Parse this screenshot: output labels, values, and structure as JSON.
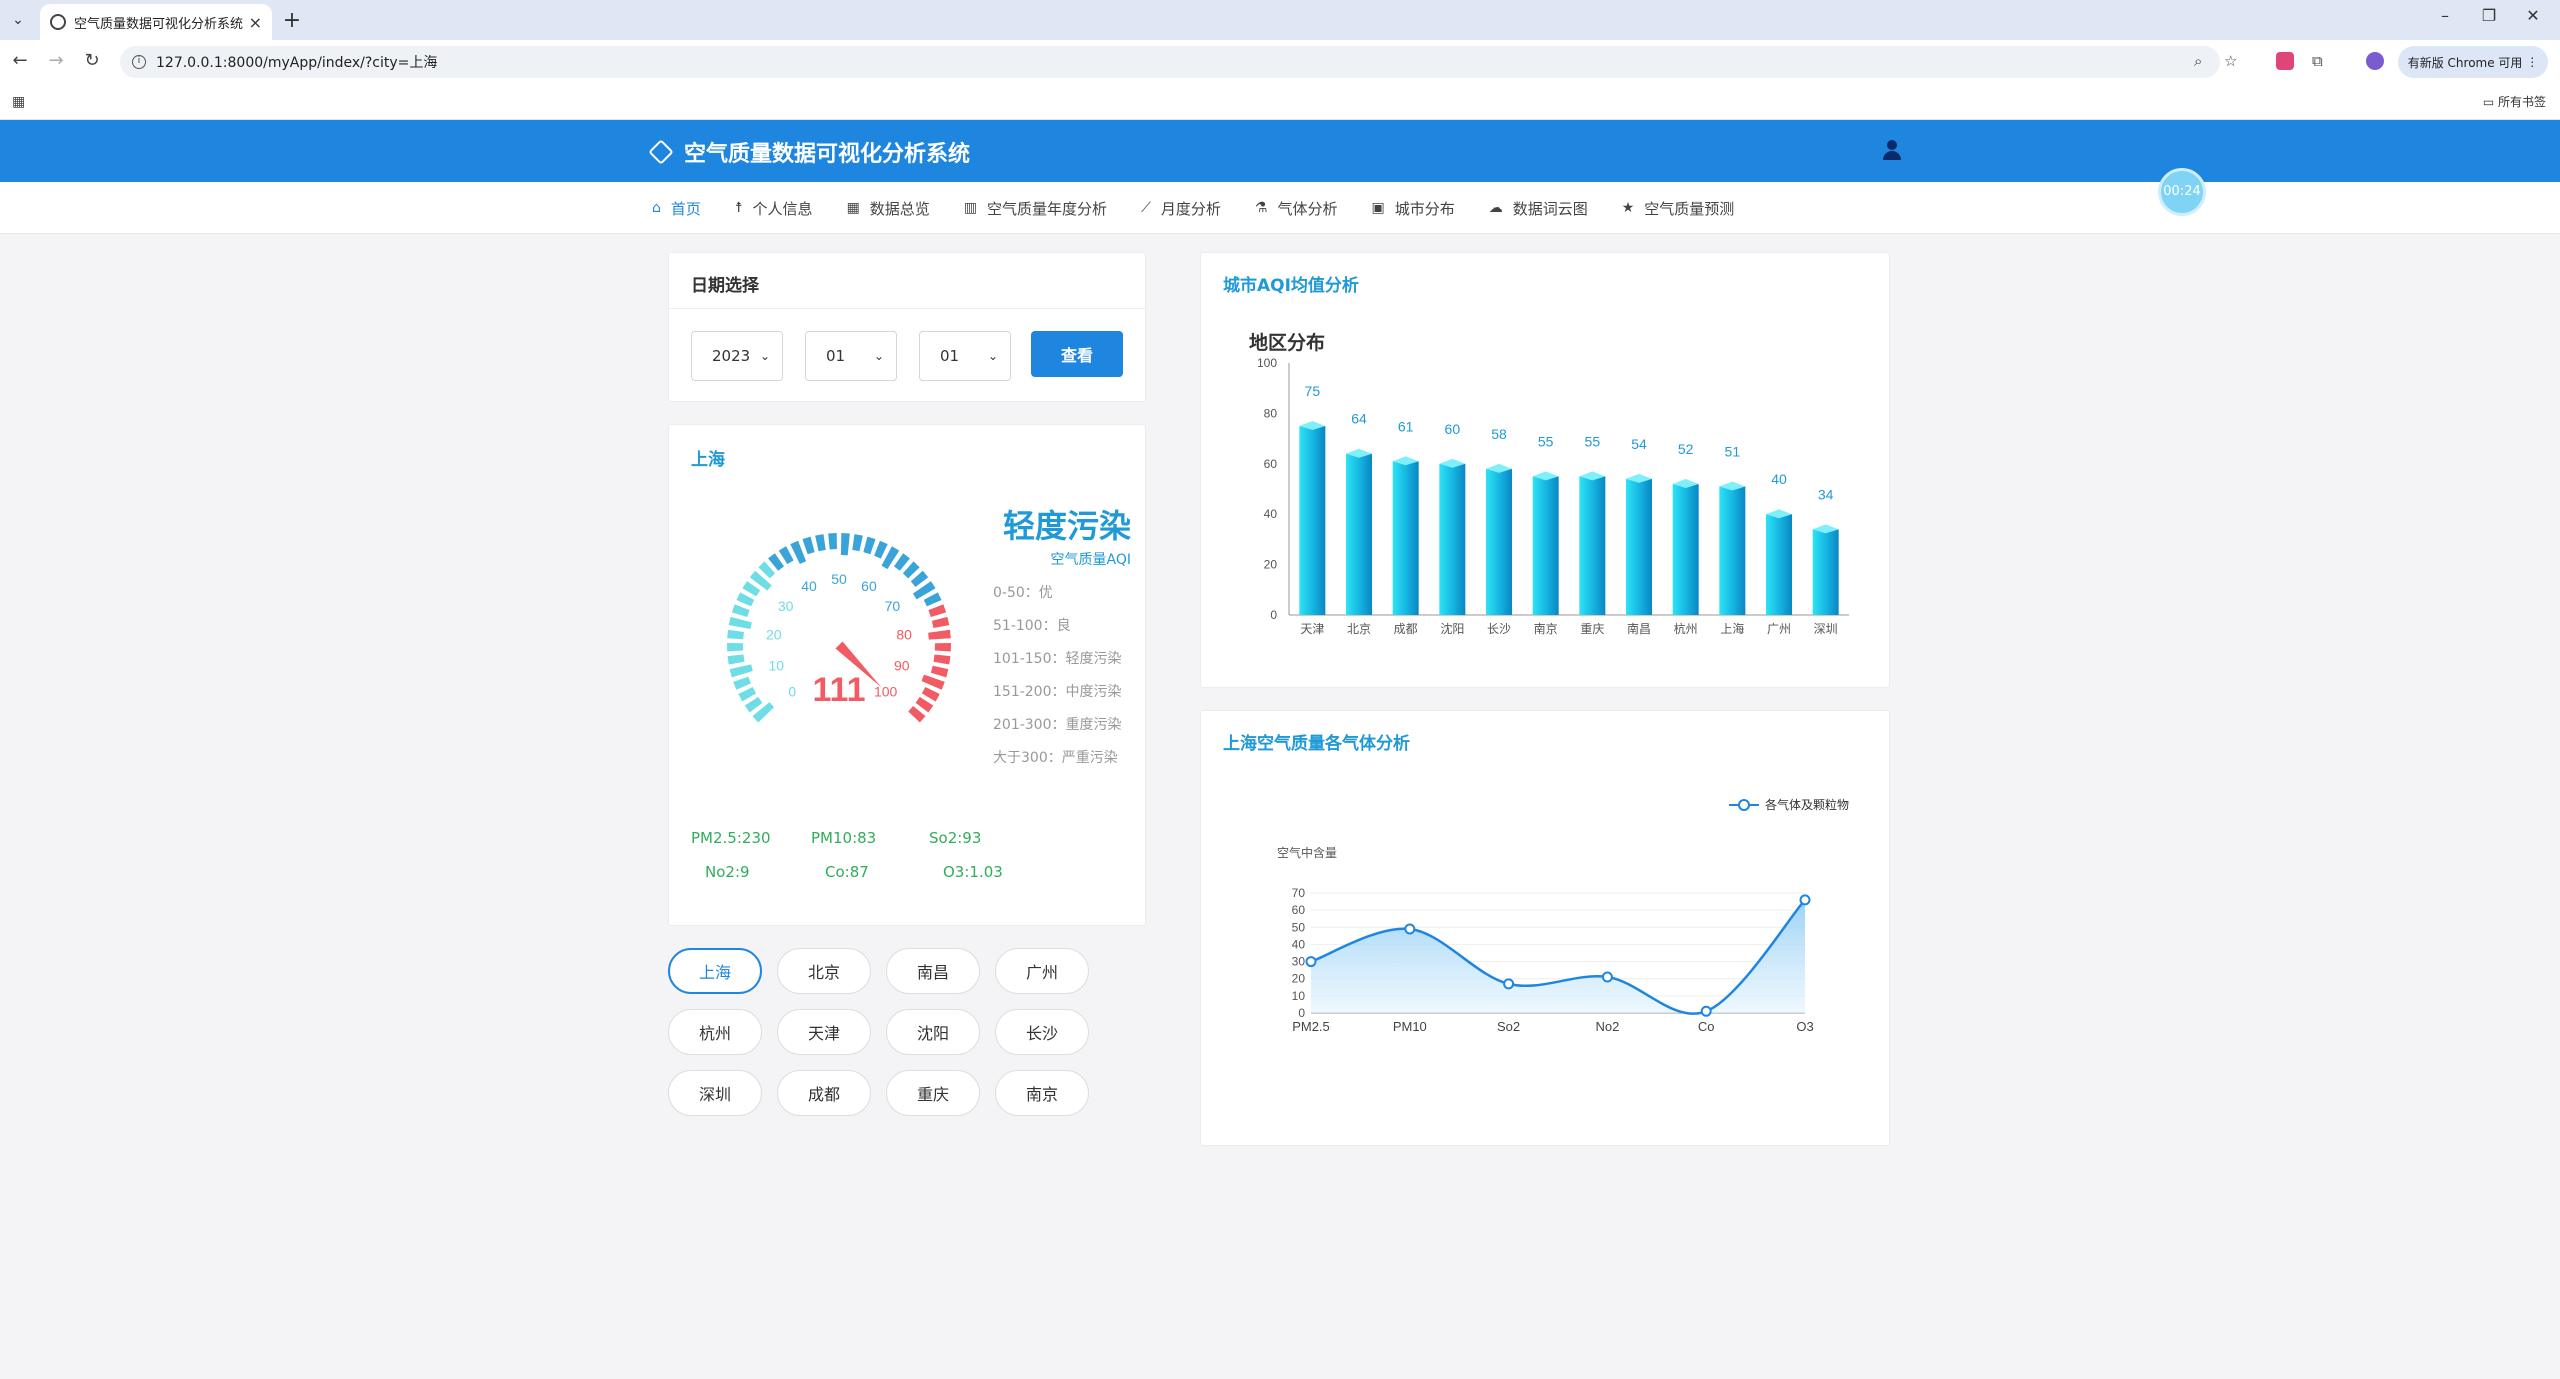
{
  "browser": {
    "tab_title": "空气质量数据可视化分析系统",
    "url": "127.0.0.1:8000/myApp/index/?city=上海",
    "update_button": "有新版 Chrome 可用",
    "all_bookmarks": "所有书签"
  },
  "app": {
    "title": "空气质量数据可视化分析系统",
    "timer": "00:24",
    "nav": [
      {
        "label": "首页",
        "icon": "home-icon",
        "glyph": "⌂"
      },
      {
        "label": "个人信息",
        "icon": "person-icon",
        "glyph": "☨"
      },
      {
        "label": "数据总览",
        "icon": "table-icon",
        "glyph": "▦"
      },
      {
        "label": "空气质量年度分析",
        "icon": "bar-chart-icon",
        "glyph": "▥"
      },
      {
        "label": "月度分析",
        "icon": "line-chart-icon",
        "glyph": "⟋"
      },
      {
        "label": "气体分析",
        "icon": "gas-icon",
        "glyph": "⚗"
      },
      {
        "label": "城市分布",
        "icon": "map-icon",
        "glyph": "▣"
      },
      {
        "label": "数据词云图",
        "icon": "cloud-icon",
        "glyph": "☁"
      },
      {
        "label": "空气质量预测",
        "icon": "star-icon",
        "glyph": "★"
      }
    ]
  },
  "date_select": {
    "title": "日期选择",
    "year": "2023",
    "month": "01",
    "day": "01",
    "view_button": "查看"
  },
  "city_panel": {
    "city": "上海",
    "aqi": 111,
    "gauge_max": 100,
    "gauge_ticks": [
      "0",
      "10",
      "20",
      "30",
      "40",
      "50",
      "60",
      "70",
      "80",
      "90",
      "100"
    ],
    "level": "轻度污染",
    "level_sub": "空气质量AQI",
    "legend": [
      "0-50：优",
      "51-100：良",
      "101-150：轻度污染",
      "151-200：中度污染",
      "201-300：重度污染",
      "大于300：严重污染"
    ],
    "pollutants": [
      [
        "PM2.5:230",
        "PM10:83",
        "So2:93"
      ],
      [
        "No2:9",
        "Co:87",
        "O3:1.03"
      ]
    ]
  },
  "cities": [
    "上海",
    "北京",
    "南昌",
    "广州",
    "杭州",
    "天津",
    "沈阳",
    "长沙",
    "深圳",
    "成都",
    "重庆",
    "南京"
  ],
  "active_city": "上海",
  "colors": {
    "accent": "#1f86e0",
    "title_blue": "#1f9ad6",
    "green": "#2fae5a",
    "gauge_red": "#f25b63",
    "gauge_cyan": "#6fdde6",
    "gauge_blue": "#3aa3d8"
  },
  "chart_data": [
    {
      "type": "bar",
      "card_title": "城市AQI均值分析",
      "title": "地区分布",
      "categories": [
        "天津",
        "北京",
        "成都",
        "沈阳",
        "长沙",
        "南京",
        "重庆",
        "南昌",
        "杭州",
        "上海",
        "广州",
        "深圳"
      ],
      "values": [
        75,
        64,
        61,
        60,
        58,
        55,
        55,
        54,
        52,
        51,
        40,
        34
      ],
      "ylim": [
        0,
        100
      ],
      "yticks": [
        "0",
        "20",
        "40",
        "60",
        "80",
        "100"
      ]
    },
    {
      "type": "area",
      "card_title": "上海空气质量各气体分析",
      "ylabel": "空气中含量",
      "categories": [
        "PM2.5",
        "PM10",
        "So2",
        "No2",
        "Co",
        "O3"
      ],
      "series": [
        {
          "name": "各气体及颗粒物",
          "values": [
            30,
            49,
            17,
            21,
            1,
            66
          ]
        }
      ],
      "ylim": [
        0,
        70
      ],
      "yticks": [
        "0",
        "10",
        "20",
        "30",
        "40",
        "50",
        "60",
        "70"
      ]
    }
  ]
}
